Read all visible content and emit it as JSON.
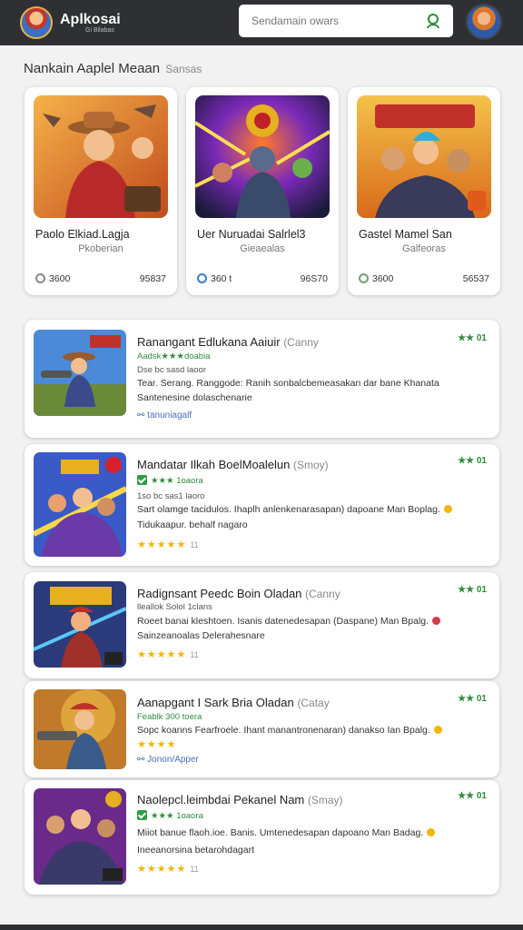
{
  "header": {
    "brand_name": "Aplkosai",
    "brand_sub": "Gi Bilabas",
    "search_placeholder": "Sendamain owars"
  },
  "section": {
    "title": "Nankain Aaplel Meaan",
    "subtitle": "Sansas"
  },
  "featured": [
    {
      "title": "Paolo Elkiad.Lagja",
      "subtitle": "Pkoberian",
      "left_stat": "3600",
      "right_stat": "95837"
    },
    {
      "title": "Uer Nuruadai Salrlel3",
      "subtitle": "Gieaealas",
      "left_stat": "360 t",
      "right_stat": "96S70"
    },
    {
      "title": "Gastel Mamel San",
      "subtitle": "Galfeoras",
      "left_stat": "3600",
      "right_stat": "56537"
    }
  ],
  "list": [
    {
      "title": "Ranangant Edlukana Aaiuir",
      "developer": "(Canny",
      "rating_line": "Aadsk★★★doabia",
      "meta_line": "Dse bc sasd laoor",
      "desc1": "Tear. Serang. Ranggode: Ranih sonbalcbemeasakan dar bane Khanata",
      "desc2": "Santenesine dolaschenarie",
      "tag": "tanuniagalf",
      "stars": "★★★★★",
      "star_count": "",
      "score": "★★ 01"
    },
    {
      "title": "Mandatar Ilkah BoelMoalelun",
      "developer": "(Smoy)",
      "rating_line": "★★★ 1oaora",
      "meta_line": "1so bc sas1 laoro",
      "desc1": "Sart olamge tacidulos. Ihaplh anlenkenarasapan) dapoane Man Boplag.",
      "desc2": "Tidukaapur. behalf nagaro",
      "tag": "",
      "stars": "★★★★★",
      "star_count": "11",
      "score": "★★ 01"
    },
    {
      "title": "Radignsant Peedc Boin Oladan",
      "developer": "(Canny",
      "rating_line": "lleallok Solol 1clans",
      "meta_line": "",
      "desc1": "Roeet banai kleshtoen. Isanis datenedesapan (Daspane) Man Bpalg.",
      "desc2": "Sainzeanoalas Delerahesnare",
      "tag": "",
      "stars": "★★★★★",
      "star_count": "11",
      "score": "★★ 01"
    },
    {
      "title": "Aanapgant I Sark Bria Oladan",
      "developer": "(Catay",
      "rating_line": "Feablk 300 toera",
      "meta_line": "",
      "desc1": "Sopc koanns Fearfroele. Ihant manantronenaran) danakso Ian Bpalg.",
      "desc2": "",
      "tag": "Jonon/Apper",
      "stars": "★★★★",
      "star_count": "",
      "score": "★★ 01"
    },
    {
      "title": "Naolepcl.leimbdai Pekanel Nam",
      "developer": "(Smay)",
      "rating_line": "★★★ 1oaora",
      "meta_line": "",
      "desc1": "Miiot banue flaoh.ioe. Banis. Umtenedesapan dapoano Man Badag.",
      "desc2": "Ineeanorsina betarohdagart",
      "tag": "",
      "stars": "★★★★★",
      "star_count": "11",
      "score": "★★ 01"
    }
  ]
}
